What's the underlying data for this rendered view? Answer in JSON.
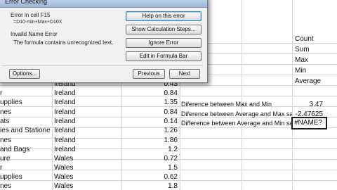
{
  "rows": [
    {
      "product": "",
      "region": "Ireland",
      "sales": "0.43"
    },
    {
      "product": "r",
      "region": "Ireland",
      "sales": "0.84"
    },
    {
      "product": "upplies",
      "region": "Ireland",
      "sales": "1.35"
    },
    {
      "product": "nes",
      "region": "Ireland",
      "sales": "0.84"
    },
    {
      "product": "ats",
      "region": "Ireland",
      "sales": "0.14"
    },
    {
      "product": "ies and Stationer",
      "region": "Ireland",
      "sales": "1.26"
    },
    {
      "product": "nes",
      "region": "Ireland",
      "sales": "1.86"
    },
    {
      "product": "and Bags",
      "region": "Ireland",
      "sales": "1.2"
    },
    {
      "product": "ure",
      "region": "Wales",
      "sales": "0.72"
    },
    {
      "product": "r",
      "region": "Wales",
      "sales": "1.5"
    },
    {
      "product": "upplies",
      "region": "Wales",
      "sales": "0.62"
    },
    {
      "product": "nes",
      "region": "Wales",
      "sales": "1.8"
    }
  ],
  "stats_labels": [
    "Count",
    "Sum",
    "Max",
    "Min",
    "Average"
  ],
  "differences": [
    {
      "label": "Diference between Max and Min",
      "value": "3.47"
    },
    {
      "label": "Diference between Average and Max sales",
      "value": "-2.47625"
    },
    {
      "label": "Difference between Average and Min sales",
      "value": "#NAME?"
    }
  ],
  "dialog": {
    "title": "Error Checking",
    "error_in_cell": "Error in cell F15",
    "formula": "=D10-min+Max+D10X",
    "error_name": "Invalid Name Error",
    "error_desc": "The formula contains unrecognized text.",
    "buttons": {
      "help": "Help on this error",
      "show_steps": "Show Calculation Steps...",
      "ignore": "Ignore Error",
      "edit": "Edit in Formula Bar",
      "options": "Options...",
      "previous": "Previous",
      "next": "Next"
    }
  }
}
